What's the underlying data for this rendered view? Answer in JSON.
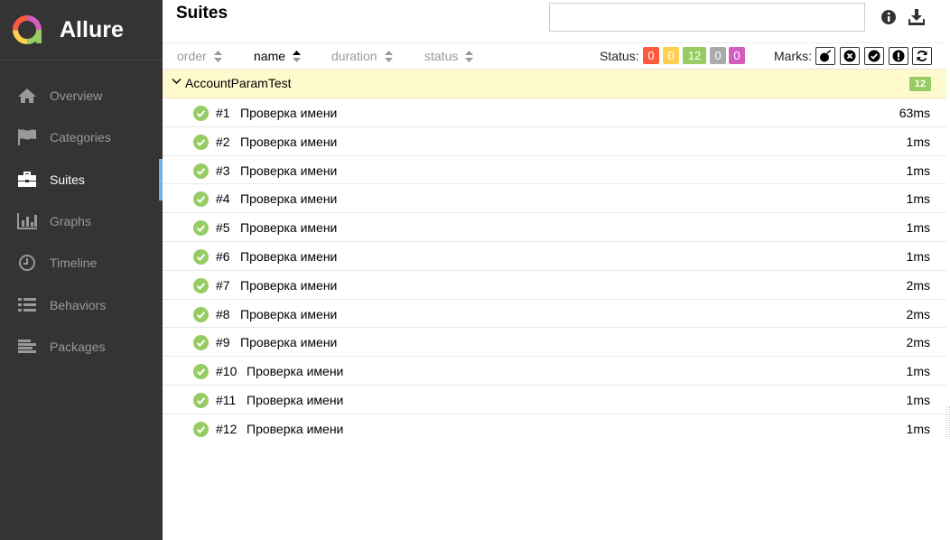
{
  "app": {
    "brand": "Allure"
  },
  "sidebar": {
    "items": [
      {
        "label": "Overview",
        "icon": "home-icon"
      },
      {
        "label": "Categories",
        "icon": "flag-icon"
      },
      {
        "label": "Suites",
        "icon": "briefcase-icon",
        "active": true
      },
      {
        "label": "Graphs",
        "icon": "bar-chart-icon"
      },
      {
        "label": "Timeline",
        "icon": "clock-icon"
      },
      {
        "label": "Behaviors",
        "icon": "list-icon"
      },
      {
        "label": "Packages",
        "icon": "align-left-icon"
      }
    ]
  },
  "header": {
    "title": "Suites",
    "search": {
      "value": "",
      "placeholder": ""
    },
    "info_icon": "info-icon",
    "download_icon": "download-icon"
  },
  "toolbar": {
    "sort_columns": [
      {
        "label": "order",
        "active": false
      },
      {
        "label": "name",
        "active": true
      },
      {
        "label": "duration",
        "active": false
      },
      {
        "label": "status",
        "active": false
      }
    ],
    "status_label": "Status:",
    "status_counts": [
      {
        "name": "failed",
        "value": "0",
        "color": "#fd5a3e"
      },
      {
        "name": "broken",
        "value": "0",
        "color": "#ffd050"
      },
      {
        "name": "passed",
        "value": "12",
        "color": "#97cc64"
      },
      {
        "name": "skipped",
        "value": "0",
        "color": "#aaaaaa"
      },
      {
        "name": "unknown",
        "value": "0",
        "color": "#d35ebe"
      }
    ],
    "marks_label": "Marks:",
    "marks": [
      "bomb-icon",
      "times-circle-icon",
      "check-circle-icon",
      "exclamation-circle-icon",
      "refresh-icon"
    ]
  },
  "suite": {
    "name": "AccountParamTest",
    "count": "12",
    "tests": [
      {
        "num": "#1",
        "name": "Проверка имени",
        "duration": "63ms"
      },
      {
        "num": "#2",
        "name": "Проверка имени",
        "duration": "1ms"
      },
      {
        "num": "#3",
        "name": "Проверка имени",
        "duration": "1ms"
      },
      {
        "num": "#4",
        "name": "Проверка имени",
        "duration": "1ms"
      },
      {
        "num": "#5",
        "name": "Проверка имени",
        "duration": "1ms"
      },
      {
        "num": "#6",
        "name": "Проверка имени",
        "duration": "1ms"
      },
      {
        "num": "#7",
        "name": "Проверка имени",
        "duration": "2ms"
      },
      {
        "num": "#8",
        "name": "Проверка имени",
        "duration": "2ms"
      },
      {
        "num": "#9",
        "name": "Проверка имени",
        "duration": "2ms"
      },
      {
        "num": "#10",
        "name": "Проверка имени",
        "duration": "1ms"
      },
      {
        "num": "#11",
        "name": "Проверка имени",
        "duration": "1ms"
      },
      {
        "num": "#12",
        "name": "Проверка имени",
        "duration": "1ms"
      }
    ]
  },
  "colors": {
    "sidebar_bg": "#343434",
    "accent": "#6eb4e6",
    "passed": "#97cc64",
    "suite_highlight": "#fffacd"
  }
}
